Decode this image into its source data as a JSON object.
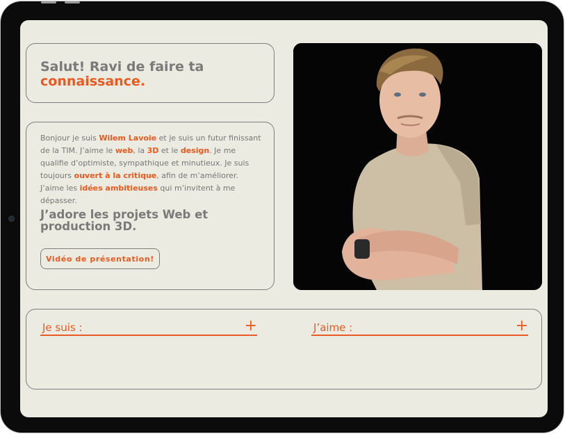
{
  "greeting": {
    "line1": "Salut! Ravi de faire ta",
    "line2": "connaissance."
  },
  "about": {
    "t1": "Bonjour je suis ",
    "name": "Wilem Lavoie",
    "t2": " et je suis un futur finissant de la TIM. J’aime le ",
    "web": "web",
    "t3": ", la ",
    "three_d": "3D",
    "t4": " et le ",
    "design": "design",
    "t5": ". Je me qualifie d’optimiste, sympathique et minutieux. Je suis toujours ",
    "critique": "ouvert à la critique",
    "t6": ", afin de m’améliorer. J’aime les ",
    "idees": "idées ambitieuses",
    "t7": " qui m’invitent à me dépasser.",
    "heading": "J’adore les projets Web et production 3D.",
    "video_button": "Vidéo de présentation!"
  },
  "accordion": [
    {
      "label": "Je suis :",
      "icon": "plus-icon",
      "symbol": "+"
    },
    {
      "label": "J’aime :",
      "icon": "plus-icon",
      "symbol": "+"
    }
  ],
  "colors": {
    "accent": "#ea5a20",
    "background": "#ecebe1",
    "text": "#777777",
    "border": "#7d7d7d"
  }
}
